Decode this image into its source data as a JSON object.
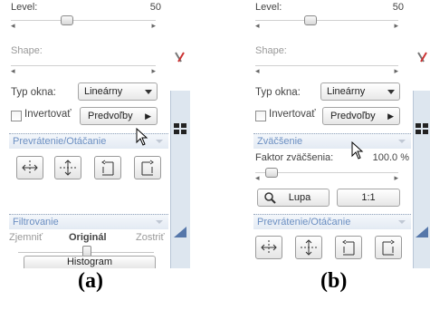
{
  "panel_a": {
    "level_label": "Level:",
    "level_value": "50",
    "level_slider": 0.35,
    "shape_label": "Shape:",
    "typ_okna_label": "Typ okna:",
    "typ_okna_value": "Lineárny",
    "invertovat_label": "Invertovať",
    "predvolby_label": "Predvoľby",
    "section_prevratenie": "Prevrátenie/Otáčanie",
    "section_filtrovanie": "Filtrovanie",
    "zjemnit_label": "Zjemniť",
    "original_label": "Originál",
    "zostrit_label": "Zostriť",
    "histogram_label": "Histogram"
  },
  "panel_b": {
    "level_label": "Level:",
    "level_value": "50",
    "level_slider": 0.35,
    "shape_label": "Shape:",
    "typ_okna_label": "Typ okna:",
    "typ_okna_value": "Lineárny",
    "invertovat_label": "Invertovať",
    "predvolby_label": "Predvoľby",
    "section_zvacsenie": "Zväčšenie",
    "faktor_label": "Faktor zväčšenia:",
    "faktor_value": "100.0 %",
    "lupa_label": "Lupa",
    "ratio_label": "1:1",
    "section_prevratenie": "Prevrátenie/Otáčanie"
  },
  "captions": {
    "a": "(a)",
    "b": "(b)"
  },
  "icons": {
    "flip_horizontal": "flip-horizontal-icon",
    "flip_vertical": "flip-vertical-icon",
    "rotate_left": "rotate-left-icon",
    "rotate_right": "rotate-right-icon",
    "magnifier": "magnifier-icon",
    "cursor": "arrow-cursor-icon"
  },
  "colors": {
    "section_text": "#6b8fc2",
    "sidebar": "#dde6ef"
  }
}
